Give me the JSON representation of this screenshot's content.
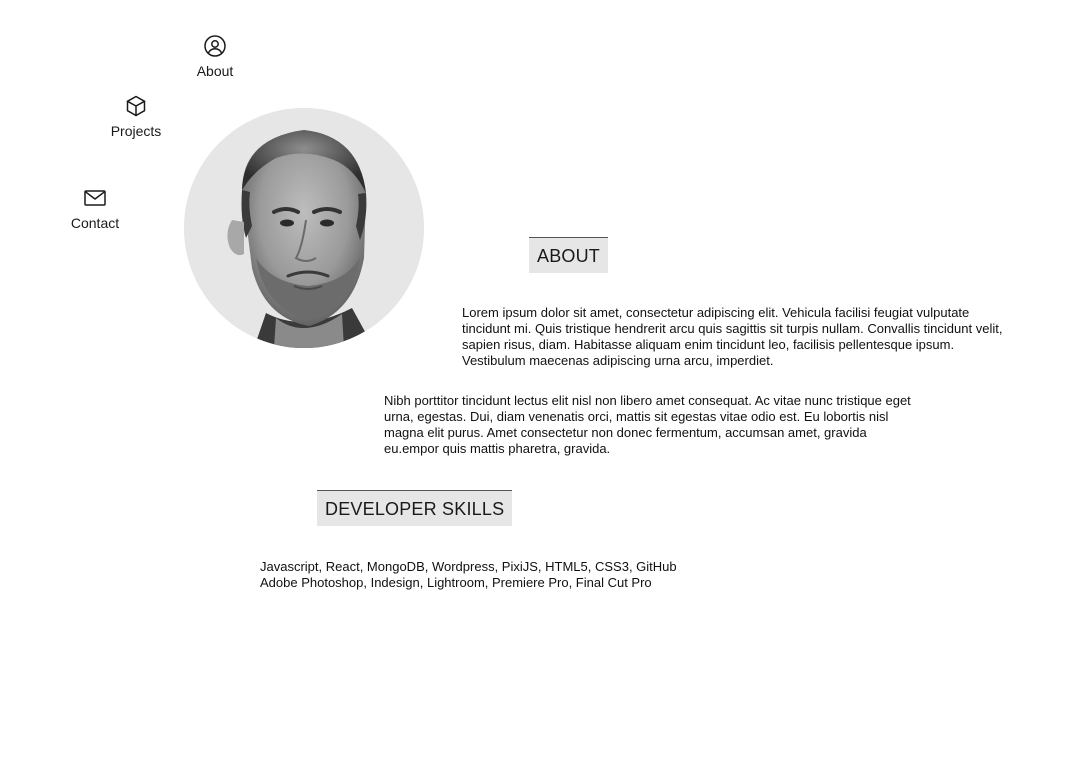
{
  "nav": {
    "about": {
      "label": "About",
      "icon": "user-circle-icon"
    },
    "projects": {
      "label": "Projects",
      "icon": "cube-icon"
    },
    "contact": {
      "label": "Contact",
      "icon": "envelope-icon"
    }
  },
  "profile": {
    "avatar": "portrait-photo"
  },
  "about": {
    "heading": "ABOUT",
    "paragraphs": [
      "Lorem ipsum dolor sit amet, consectetur adipiscing elit. Vehicula facilisi feugiat vulputate tincidunt mi. Quis tristique hendrerit arcu quis sagittis sit turpis nullam. Convallis tincidunt velit, sapien risus, diam. Habitasse aliquam enim tincidunt leo, facilisis pellentesque ipsum. Vestibulum maecenas adipiscing urna arcu, imperdiet.",
      "Nibh porttitor tincidunt lectus elit nisl non libero amet consequat. Ac vitae nunc tristique eget urna, egestas. Dui, diam venenatis orci, mattis sit egestas vitae odio est. Eu lobortis nisl magna elit purus. Amet consectetur non donec fermentum, accumsan amet, gravida eu.empor quis mattis pharetra, gravida."
    ]
  },
  "skills": {
    "heading": "DEVELOPER SKILLS",
    "lines": [
      "Javascript, React, MongoDB, Wordpress, PixiJS, HTML5, CSS3, GitHub",
      "Adobe Photoshop, Indesign, Lightroom, Premiere Pro, Final Cut Pro"
    ]
  },
  "colors": {
    "heading_bg": "#e6e6e6",
    "text": "#1a1a1a"
  }
}
